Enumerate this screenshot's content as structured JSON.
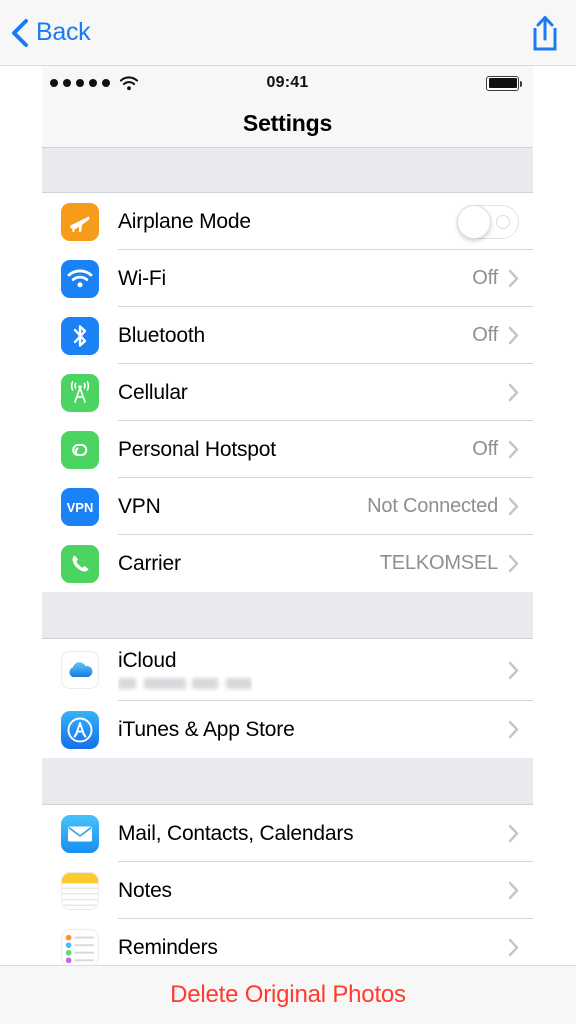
{
  "navbar": {
    "back_label": "Back",
    "back_icon": "chevron-left-icon",
    "share_icon": "share-icon",
    "accent_color": "#1a7bf2"
  },
  "statusbar": {
    "signal_dots": 5,
    "signal_icon": "signal-dots-icon",
    "wifi_icon": "wifi-icon",
    "time": "09:41",
    "battery_icon": "battery-full-icon",
    "battery_level": 100
  },
  "screen": {
    "title": "Settings"
  },
  "groups": [
    {
      "rows": [
        {
          "label": "Airplane Mode",
          "icon": "airplane-icon",
          "icon_color": "#f79c1a",
          "control": "toggle",
          "toggle_on": false,
          "value": "",
          "chevron": false
        },
        {
          "label": "Wi-Fi",
          "icon": "wifi-icon",
          "icon_color": "#1a82f5",
          "control": "value",
          "value": "Off",
          "chevron": true
        },
        {
          "label": "Bluetooth",
          "icon": "bluetooth-icon",
          "icon_color": "#1a82f5",
          "control": "value",
          "value": "Off",
          "chevron": true
        },
        {
          "label": "Cellular",
          "icon": "cellular-tower-icon",
          "icon_color": "#4cd463",
          "control": "value",
          "value": "",
          "chevron": true
        },
        {
          "label": "Personal Hotspot",
          "icon": "hotspot-link-icon",
          "icon_color": "#4cd463",
          "control": "value",
          "value": "Off",
          "chevron": true
        },
        {
          "label": "VPN",
          "icon": "vpn-icon",
          "icon_color": "#1a82f5",
          "control": "value",
          "value": "Not Connected",
          "chevron": true
        },
        {
          "label": "Carrier",
          "icon": "phone-icon",
          "icon_color": "#4cd463",
          "control": "value",
          "value": "TELKOMSEL",
          "chevron": true
        }
      ]
    },
    {
      "rows": [
        {
          "label": "iCloud",
          "icon": "icloud-icon",
          "icon_color": "#ffffff",
          "control": "value",
          "value": "",
          "subtitle_redacted": true,
          "chevron": true
        },
        {
          "label": "iTunes & App Store",
          "icon": "app-store-icon",
          "icon_color": "#1a82f5",
          "control": "value",
          "value": "",
          "chevron": true
        }
      ]
    },
    {
      "rows": [
        {
          "label": "Mail, Contacts, Calendars",
          "icon": "mail-icon",
          "icon_color": "#2fa5f5",
          "control": "value",
          "value": "",
          "chevron": true
        },
        {
          "label": "Notes",
          "icon": "notes-icon",
          "icon_color": "#fecb2e",
          "control": "value",
          "value": "",
          "chevron": true
        },
        {
          "label": "Reminders",
          "icon": "reminders-icon",
          "icon_color": "#ffffff",
          "control": "value",
          "value": "",
          "chevron": true
        }
      ]
    }
  ],
  "footer": {
    "label": "Delete Original Photos",
    "color": "#ff3b30"
  }
}
